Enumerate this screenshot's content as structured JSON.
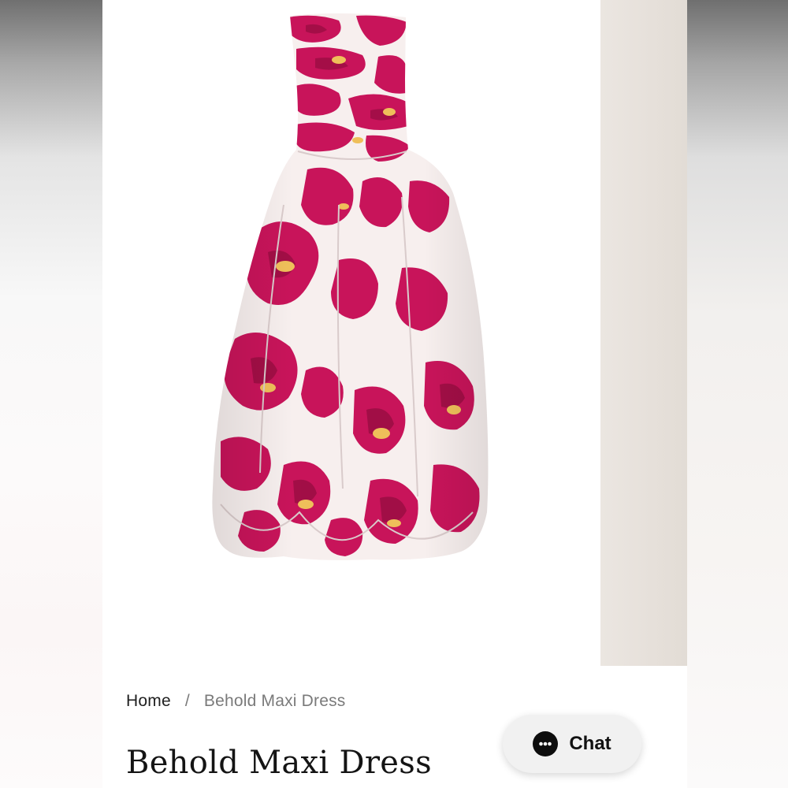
{
  "breadcrumb": {
    "home": "Home",
    "separator": "/",
    "current": "Behold Maxi Dress"
  },
  "product": {
    "title": "Behold Maxi Dress",
    "image_alt": "Behold Maxi Dress",
    "print_colors": {
      "fabric": "#f7efee",
      "magenta": "#c8145a",
      "deep": "#9b0d43",
      "ochre": "#efbf5a"
    }
  },
  "chat": {
    "label": "Chat",
    "icon": "chat-bubble-icon"
  }
}
